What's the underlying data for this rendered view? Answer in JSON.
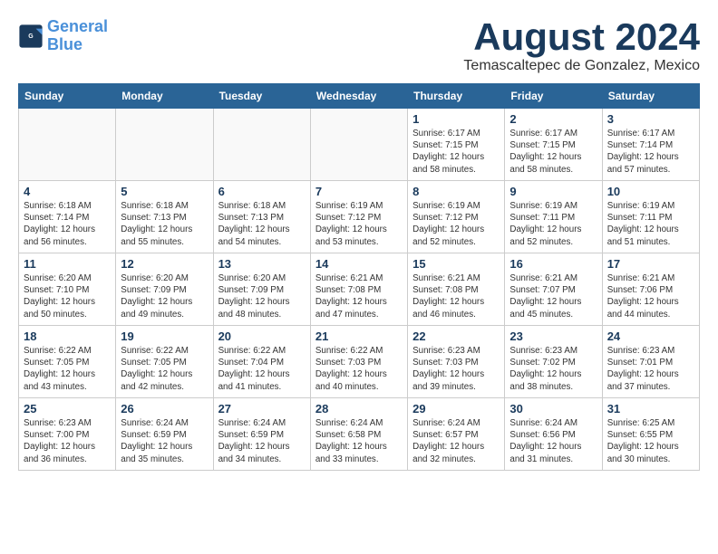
{
  "header": {
    "logo_line1": "General",
    "logo_line2": "Blue",
    "month_title": "August 2024",
    "location": "Temascaltepec de Gonzalez, Mexico"
  },
  "days_of_week": [
    "Sunday",
    "Monday",
    "Tuesday",
    "Wednesday",
    "Thursday",
    "Friday",
    "Saturday"
  ],
  "weeks": [
    [
      {
        "day": "",
        "info": ""
      },
      {
        "day": "",
        "info": ""
      },
      {
        "day": "",
        "info": ""
      },
      {
        "day": "",
        "info": ""
      },
      {
        "day": "1",
        "info": "Sunrise: 6:17 AM\nSunset: 7:15 PM\nDaylight: 12 hours\nand 58 minutes."
      },
      {
        "day": "2",
        "info": "Sunrise: 6:17 AM\nSunset: 7:15 PM\nDaylight: 12 hours\nand 58 minutes."
      },
      {
        "day": "3",
        "info": "Sunrise: 6:17 AM\nSunset: 7:14 PM\nDaylight: 12 hours\nand 57 minutes."
      }
    ],
    [
      {
        "day": "4",
        "info": "Sunrise: 6:18 AM\nSunset: 7:14 PM\nDaylight: 12 hours\nand 56 minutes."
      },
      {
        "day": "5",
        "info": "Sunrise: 6:18 AM\nSunset: 7:13 PM\nDaylight: 12 hours\nand 55 minutes."
      },
      {
        "day": "6",
        "info": "Sunrise: 6:18 AM\nSunset: 7:13 PM\nDaylight: 12 hours\nand 54 minutes."
      },
      {
        "day": "7",
        "info": "Sunrise: 6:19 AM\nSunset: 7:12 PM\nDaylight: 12 hours\nand 53 minutes."
      },
      {
        "day": "8",
        "info": "Sunrise: 6:19 AM\nSunset: 7:12 PM\nDaylight: 12 hours\nand 52 minutes."
      },
      {
        "day": "9",
        "info": "Sunrise: 6:19 AM\nSunset: 7:11 PM\nDaylight: 12 hours\nand 52 minutes."
      },
      {
        "day": "10",
        "info": "Sunrise: 6:19 AM\nSunset: 7:11 PM\nDaylight: 12 hours\nand 51 minutes."
      }
    ],
    [
      {
        "day": "11",
        "info": "Sunrise: 6:20 AM\nSunset: 7:10 PM\nDaylight: 12 hours\nand 50 minutes."
      },
      {
        "day": "12",
        "info": "Sunrise: 6:20 AM\nSunset: 7:09 PM\nDaylight: 12 hours\nand 49 minutes."
      },
      {
        "day": "13",
        "info": "Sunrise: 6:20 AM\nSunset: 7:09 PM\nDaylight: 12 hours\nand 48 minutes."
      },
      {
        "day": "14",
        "info": "Sunrise: 6:21 AM\nSunset: 7:08 PM\nDaylight: 12 hours\nand 47 minutes."
      },
      {
        "day": "15",
        "info": "Sunrise: 6:21 AM\nSunset: 7:08 PM\nDaylight: 12 hours\nand 46 minutes."
      },
      {
        "day": "16",
        "info": "Sunrise: 6:21 AM\nSunset: 7:07 PM\nDaylight: 12 hours\nand 45 minutes."
      },
      {
        "day": "17",
        "info": "Sunrise: 6:21 AM\nSunset: 7:06 PM\nDaylight: 12 hours\nand 44 minutes."
      }
    ],
    [
      {
        "day": "18",
        "info": "Sunrise: 6:22 AM\nSunset: 7:05 PM\nDaylight: 12 hours\nand 43 minutes."
      },
      {
        "day": "19",
        "info": "Sunrise: 6:22 AM\nSunset: 7:05 PM\nDaylight: 12 hours\nand 42 minutes."
      },
      {
        "day": "20",
        "info": "Sunrise: 6:22 AM\nSunset: 7:04 PM\nDaylight: 12 hours\nand 41 minutes."
      },
      {
        "day": "21",
        "info": "Sunrise: 6:22 AM\nSunset: 7:03 PM\nDaylight: 12 hours\nand 40 minutes."
      },
      {
        "day": "22",
        "info": "Sunrise: 6:23 AM\nSunset: 7:03 PM\nDaylight: 12 hours\nand 39 minutes."
      },
      {
        "day": "23",
        "info": "Sunrise: 6:23 AM\nSunset: 7:02 PM\nDaylight: 12 hours\nand 38 minutes."
      },
      {
        "day": "24",
        "info": "Sunrise: 6:23 AM\nSunset: 7:01 PM\nDaylight: 12 hours\nand 37 minutes."
      }
    ],
    [
      {
        "day": "25",
        "info": "Sunrise: 6:23 AM\nSunset: 7:00 PM\nDaylight: 12 hours\nand 36 minutes."
      },
      {
        "day": "26",
        "info": "Sunrise: 6:24 AM\nSunset: 6:59 PM\nDaylight: 12 hours\nand 35 minutes."
      },
      {
        "day": "27",
        "info": "Sunrise: 6:24 AM\nSunset: 6:59 PM\nDaylight: 12 hours\nand 34 minutes."
      },
      {
        "day": "28",
        "info": "Sunrise: 6:24 AM\nSunset: 6:58 PM\nDaylight: 12 hours\nand 33 minutes."
      },
      {
        "day": "29",
        "info": "Sunrise: 6:24 AM\nSunset: 6:57 PM\nDaylight: 12 hours\nand 32 minutes."
      },
      {
        "day": "30",
        "info": "Sunrise: 6:24 AM\nSunset: 6:56 PM\nDaylight: 12 hours\nand 31 minutes."
      },
      {
        "day": "31",
        "info": "Sunrise: 6:25 AM\nSunset: 6:55 PM\nDaylight: 12 hours\nand 30 minutes."
      }
    ]
  ]
}
